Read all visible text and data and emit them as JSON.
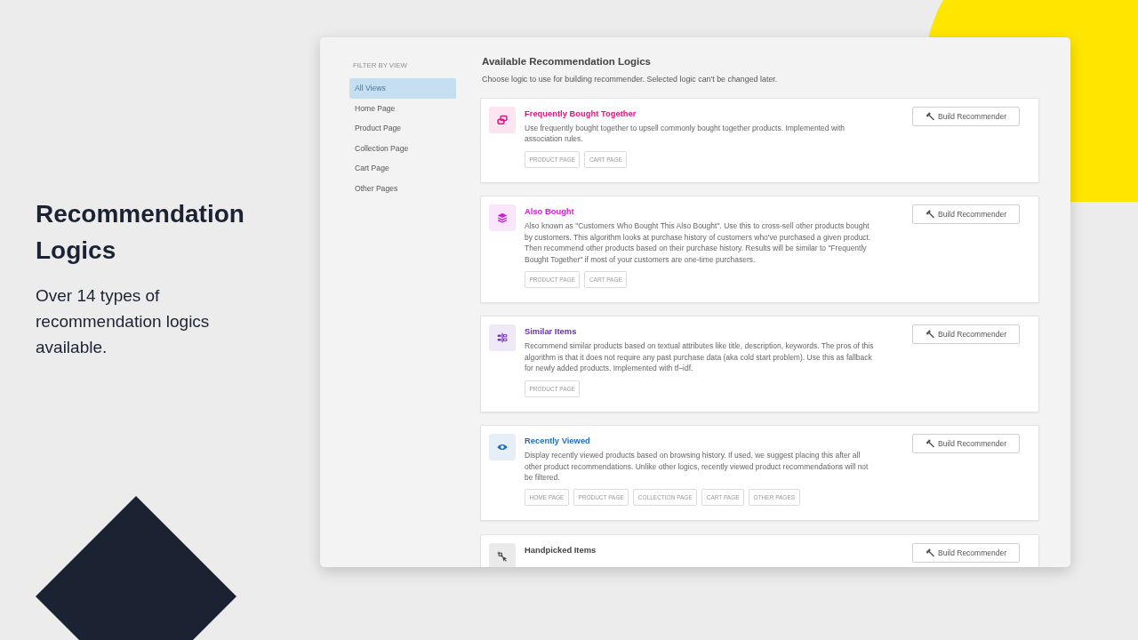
{
  "hero": {
    "title": "Recommendation Logics",
    "text": "Over 14 types of recommendation logics available."
  },
  "sidebar": {
    "heading": "FILTER BY VIEW",
    "items": [
      {
        "label": "All Views",
        "selected": true
      },
      {
        "label": "Home Page",
        "selected": false
      },
      {
        "label": "Product Page",
        "selected": false
      },
      {
        "label": "Collection Page",
        "selected": false
      },
      {
        "label": "Cart Page",
        "selected": false
      },
      {
        "label": "Other Pages",
        "selected": false
      }
    ]
  },
  "main": {
    "title": "Available Recommendation Logics",
    "subtitle": "Choose logic to use for building recommender. Selected logic can't be changed later."
  },
  "logics": [
    {
      "title": "Frequently Bought Together",
      "color": "#e3157f",
      "description": "Use frequently bought together to upsell commonly bought together products. Implemented with association rules.",
      "tags": [
        "PRODUCT PAGE",
        "CART PAGE"
      ],
      "button": "Build Recommender"
    },
    {
      "title": "Also Bought",
      "color": "#cf1fd4",
      "description": "Also known as \"Customers Who Bought This Also Bought\". Use this to cross-sell other products bought by customers. This algorithm looks at purchase history of customers who've purchased a given product. Then recommend other products based on their purchase history. Results will be similar to \"Frequently Bought Together\" if most of your customers are one-time purchasers.",
      "tags": [
        "PRODUCT PAGE",
        "CART PAGE"
      ],
      "button": "Build Recommender"
    },
    {
      "title": "Similar Items",
      "color": "#6a2bb6",
      "description": "Recommend similar products based on textual attributes like title, description, keywords. The pros of this algorithm is that it does not require any past purchase data (aka cold start problem). Use this as fallback for newly added products. Implemented with tf–idf.",
      "tags": [
        "PRODUCT PAGE"
      ],
      "button": "Build Recommender"
    },
    {
      "title": "Recently Viewed",
      "color": "#1f6fbf",
      "description": "Display recently viewed products based on browsing history. If used, we suggest placing this after all other product recommendations. Unlike other logics, recently viewed product recommendations will not be filtered.",
      "tags": [
        "HOME PAGE",
        "PRODUCT PAGE",
        "COLLECTION PAGE",
        "CART PAGE",
        "OTHER PAGES"
      ],
      "button": "Build Recommender"
    },
    {
      "title": "Handpicked Items",
      "color": "#444444",
      "button": "Build Recommender"
    }
  ]
}
